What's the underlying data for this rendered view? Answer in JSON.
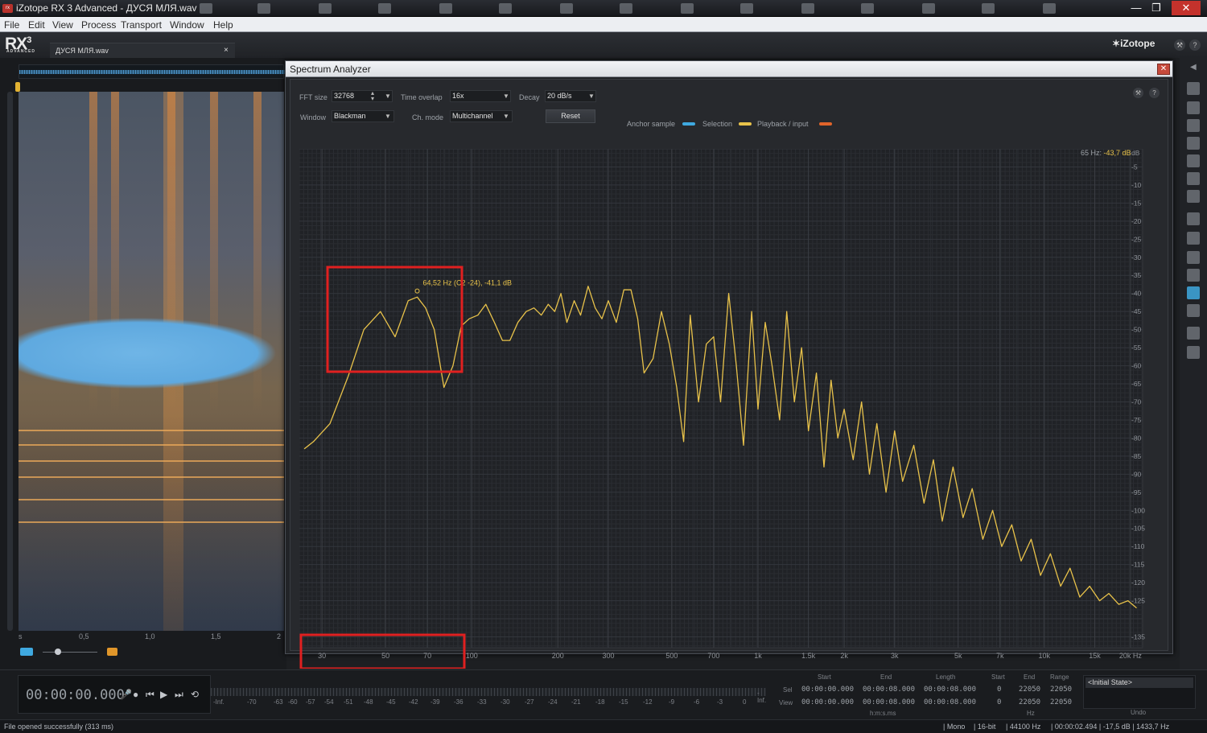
{
  "window": {
    "title": "iZotope RX 3 Advanced - ДУСЯ МЛЯ.wav",
    "minimize": "—",
    "maximize": "❐",
    "close": "✕"
  },
  "menu": [
    "File",
    "Edit",
    "View",
    "Process",
    "Transport",
    "Window",
    "Help"
  ],
  "app": {
    "logo": "RX",
    "logo_version": "3",
    "logo_sub": "ADVANCED",
    "brand": "iZotope"
  },
  "file_tab": {
    "name": "ДУСЯ МЛЯ.wav",
    "close": "×"
  },
  "timeline": {
    "ticks": [
      "s",
      "0,5",
      "1,0",
      "1,5",
      "2"
    ]
  },
  "analyzer": {
    "title": "Spectrum Analyzer",
    "fft_label": "FFT size",
    "fft_value": "32768",
    "overlap_label": "Time overlap",
    "overlap_value": "16x",
    "decay_label": "Decay",
    "decay_value": "20 dB/s",
    "window_label": "Window",
    "window_value": "Blackman",
    "chmode_label": "Ch. mode",
    "chmode_value": "Multichannel",
    "reset_label": "Reset",
    "legend": [
      {
        "label": "Anchor sample",
        "color": "#3fa9e0"
      },
      {
        "label": "Selection",
        "color": "#e8c24a"
      },
      {
        "label": "Playback / input",
        "color": "#e0642a"
      }
    ],
    "cursor_freq": "65 Hz:",
    "cursor_db": "-43,7 dB",
    "peak_annotation": "64,52 Hz (C2 -24), -41,1 dB",
    "highlight_color": "#e02020"
  },
  "chart_data": {
    "type": "line",
    "title": "",
    "xlabel": "Hz",
    "ylabel": "dB",
    "x_scale": "log",
    "xlim": [
      25,
      22050
    ],
    "ylim": [
      -138,
      0
    ],
    "grid": true,
    "x_ticks": [
      "30",
      "50",
      "70",
      "100",
      "200",
      "300",
      "500",
      "700",
      "1k",
      "1.5k",
      "2k",
      "3k",
      "5k",
      "7k",
      "10k",
      "15k",
      "20k Hz"
    ],
    "x_tick_values": [
      30,
      50,
      70,
      100,
      200,
      300,
      500,
      700,
      1000,
      1500,
      2000,
      3000,
      5000,
      7000,
      10000,
      15000,
      20000
    ],
    "y_ticks": [
      "dB",
      "-5",
      "-10",
      "-15",
      "-20",
      "-25",
      "-30",
      "-35",
      "-40",
      "-45",
      "-50",
      "-55",
      "-60",
      "-65",
      "-70",
      "-75",
      "-80",
      "-85",
      "-90",
      "-95",
      "-100",
      "-105",
      "-110",
      "-115",
      "-120",
      "-125",
      "-135"
    ],
    "y_tick_values": [
      0,
      -5,
      -10,
      -15,
      -20,
      -25,
      -30,
      -35,
      -40,
      -45,
      -50,
      -55,
      -60,
      -65,
      -70,
      -75,
      -80,
      -85,
      -90,
      -95,
      -100,
      -105,
      -110,
      -115,
      -120,
      -125,
      -135
    ],
    "series": [
      {
        "color": "#e8c24a",
        "x": [
          26,
          28,
          32,
          37,
          42,
          48,
          54,
          60,
          64.5,
          69,
          74,
          80,
          86,
          92,
          98,
          105,
          112,
          120,
          128,
          136,
          145,
          155,
          165,
          175,
          185,
          195,
          205,
          215,
          228,
          240,
          255,
          270,
          285,
          300,
          320,
          340,
          360,
          380,
          400,
          430,
          460,
          490,
          520,
          550,
          580,
          620,
          660,
          700,
          740,
          790,
          840,
          890,
          950,
          1000,
          1060,
          1120,
          1190,
          1260,
          1340,
          1420,
          1500,
          1600,
          1700,
          1800,
          1900,
          2000,
          2150,
          2300,
          2450,
          2600,
          2800,
          3000,
          3200,
          3500,
          3800,
          4100,
          4400,
          4800,
          5200,
          5600,
          6100,
          6600,
          7100,
          7700,
          8300,
          9000,
          9700,
          10500,
          11400,
          12300,
          13300,
          14400,
          15600,
          16800,
          18200,
          19600,
          21000
        ],
        "y": [
          -83,
          -81,
          -76,
          -63,
          -50,
          -45,
          -52,
          -42,
          -41,
          -44,
          -50,
          -66,
          -60,
          -49,
          -47,
          -46,
          -43,
          -48,
          -53,
          -53,
          -48,
          -45,
          -44,
          -46,
          -43,
          -45,
          -40,
          -48,
          -42,
          -46,
          -38,
          -44,
          -47,
          -42,
          -48,
          -39,
          -39,
          -47,
          -62,
          -58,
          -45,
          -54,
          -66,
          -81,
          -46,
          -70,
          -54,
          -52,
          -70,
          -40,
          -60,
          -82,
          -45,
          -72,
          -48,
          -60,
          -75,
          -45,
          -70,
          -55,
          -78,
          -62,
          -88,
          -64,
          -80,
          -72,
          -86,
          -70,
          -90,
          -76,
          -95,
          -78,
          -92,
          -82,
          -98,
          -86,
          -103,
          -88,
          -102,
          -94,
          -108,
          -100,
          -110,
          -104,
          -114,
          -108,
          -118,
          -112,
          -121,
          -116,
          -124,
          -121,
          -125,
          -123,
          -126,
          -125,
          -127
        ]
      }
    ]
  },
  "transport": {
    "time": "00:00:00.000",
    "buttons": [
      "🎤",
      "●",
      "⏮",
      "▶",
      "⏭",
      "⟲"
    ],
    "meter_ticks": [
      "-Inf.",
      "-70",
      "-63",
      "-60",
      "-57",
      "-54",
      "-51",
      "-48",
      "-45",
      "-42",
      "-39",
      "-36",
      "-33",
      "-30",
      "-27",
      "-24",
      "-21",
      "-18",
      "-15",
      "-12",
      "-9",
      "-6",
      "-3",
      "0"
    ],
    "meter_end": "-Inf."
  },
  "selection": {
    "headers": [
      "Start",
      "End",
      "Length",
      "Start",
      "End",
      "Range"
    ],
    "sel_label": "Sel",
    "view_label": "View",
    "sel_values": [
      "00:00:00.000",
      "00:00:08.000",
      "00:00:08.000",
      "0",
      "22050",
      "22050"
    ],
    "view_values": [
      "00:00:00.000",
      "00:00:08.000",
      "00:00:08.000",
      "0",
      "22050",
      "22050"
    ],
    "time_unit": "h:m:s.ms",
    "freq_unit": "Hz"
  },
  "undo": {
    "item": "<Initial State>",
    "label": "Undo"
  },
  "status": {
    "message": "File opened successfully (313 ms)",
    "channels": "Mono",
    "bitdepth": "16-bit",
    "samplerate": "44100 Hz",
    "cursor": "00:00:02.494 | -17,5 dB | 1433,7 Hz"
  }
}
